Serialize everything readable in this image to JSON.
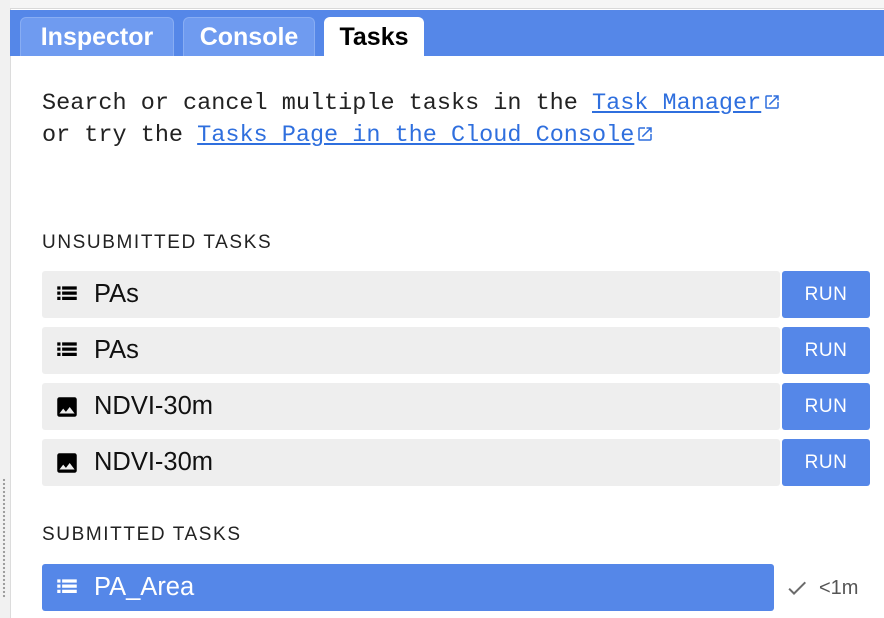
{
  "tabs": [
    {
      "label": "Inspector",
      "active": false
    },
    {
      "label": "Console",
      "active": false
    },
    {
      "label": "Tasks",
      "active": true
    }
  ],
  "intro": {
    "text1": "Search or cancel multiple tasks in the ",
    "link1": "Task Manager",
    "text2": " or try the ",
    "link2": "Tasks Page in the Cloud Console"
  },
  "unsubmitted": {
    "title": "UNSUBMITTED TASKS",
    "tasks": [
      {
        "name": "PAs",
        "icon": "table-icon",
        "button": "RUN"
      },
      {
        "name": "PAs",
        "icon": "table-icon",
        "button": "RUN"
      },
      {
        "name": "NDVI-30m",
        "icon": "image-icon",
        "button": "RUN"
      },
      {
        "name": "NDVI-30m",
        "icon": "image-icon",
        "button": "RUN"
      }
    ]
  },
  "submitted": {
    "title": "SUBMITTED TASKS",
    "tasks": [
      {
        "name": "PA_Area",
        "icon": "table-icon",
        "status_icon": "check-icon",
        "status": "<1m"
      }
    ]
  },
  "colors": {
    "accent": "#5587e8",
    "link": "#2f6fde",
    "row_bg": "#eeeeee"
  }
}
